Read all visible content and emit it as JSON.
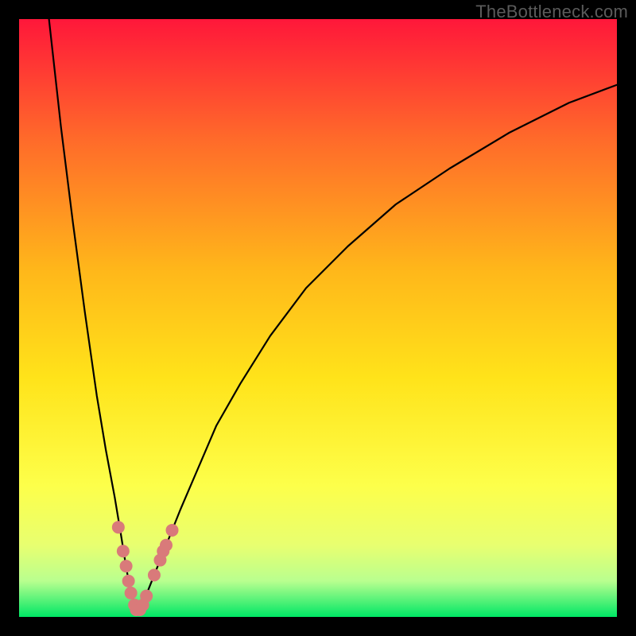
{
  "watermark": "TheBottleneck.com",
  "colors": {
    "frame": "#000000",
    "gradient_top": "#ff173a",
    "gradient_mid1": "#ff6a2a",
    "gradient_mid2": "#ffb71a",
    "gradient_mid3": "#ffe31a",
    "gradient_mid4": "#fdff4a",
    "gradient_mid5": "#e8ff70",
    "gradient_mid6": "#b9ff8f",
    "gradient_bottom": "#00e765",
    "curve": "#000000",
    "markers": "#d97a7a"
  },
  "chart_data": {
    "type": "line",
    "title": "",
    "xlabel": "",
    "ylabel": "",
    "xlim": [
      0,
      100
    ],
    "ylim": [
      0,
      100
    ],
    "series": [
      {
        "name": "curve-left",
        "x": [
          5,
          7,
          9,
          11,
          13,
          14.5,
          16,
          17,
          17.8,
          18.5,
          19.2,
          19.8
        ],
        "values": [
          100,
          82,
          66,
          51,
          37,
          28,
          20,
          14,
          9,
          5,
          2.5,
          1
        ]
      },
      {
        "name": "curve-right",
        "x": [
          19.8,
          21,
          23,
          25,
          27,
          30,
          33,
          37,
          42,
          48,
          55,
          63,
          72,
          82,
          92,
          100
        ],
        "values": [
          1,
          3,
          8,
          13,
          18,
          25,
          32,
          39,
          47,
          55,
          62,
          69,
          75,
          81,
          86,
          89
        ]
      }
    ],
    "markers": {
      "name": "highlight-dots",
      "points": [
        {
          "x": 16.6,
          "y": 15
        },
        {
          "x": 17.4,
          "y": 11
        },
        {
          "x": 17.9,
          "y": 8.5
        },
        {
          "x": 18.3,
          "y": 6
        },
        {
          "x": 18.7,
          "y": 4
        },
        {
          "x": 19.3,
          "y": 2
        },
        {
          "x": 19.6,
          "y": 1.2
        },
        {
          "x": 20.2,
          "y": 1.2
        },
        {
          "x": 20.7,
          "y": 2
        },
        {
          "x": 21.3,
          "y": 3.5
        },
        {
          "x": 22.6,
          "y": 7
        },
        {
          "x": 23.6,
          "y": 9.5
        },
        {
          "x": 24.1,
          "y": 11
        },
        {
          "x": 24.6,
          "y": 12
        },
        {
          "x": 25.6,
          "y": 14.5
        }
      ]
    }
  }
}
